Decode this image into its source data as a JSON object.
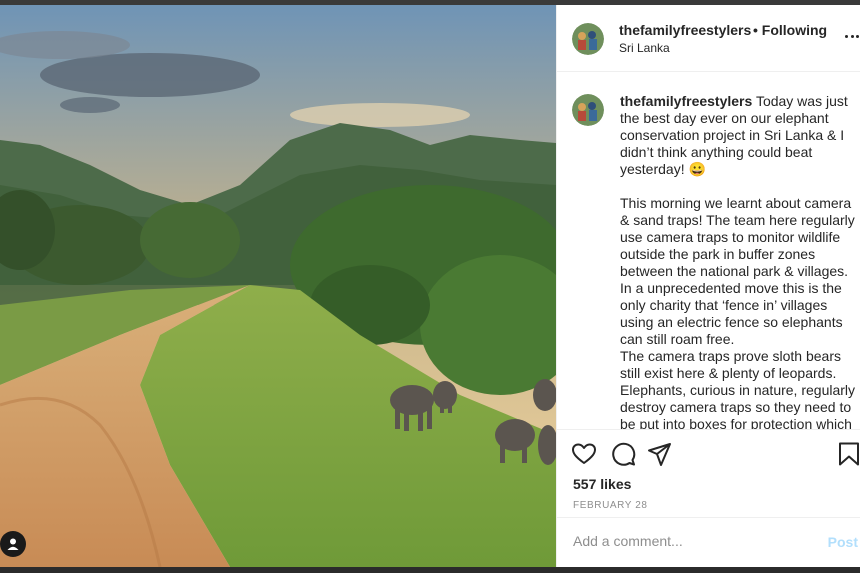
{
  "post": {
    "username": "thefamilyfreestylers",
    "follow_status": "• Following",
    "location": "Sri Lanka",
    "more_icon": "more-options-icon",
    "caption": {
      "username": "thefamilyfreestylers",
      "paragraph1": "Today was just the best day ever on our elephant conservation project in Sri Lanka & I didn’t think anything could beat yesterday! 😀",
      "paragraph2": "This morning we learnt about camera & sand traps! The team here regularly use camera traps to monitor wildlife outside the park in buffer zones between the national park & villages. In a unprecedented move this is the only charity that ‘fence in’ villages using an electric fence so elephants can still roam free.",
      "paragraph3": "The camera traps prove sloth bears still exist here & plenty of leopards. Elephants, curious in nature, regularly destroy camera traps so they need to be put into boxes for protection which is"
    },
    "actions": {
      "like_icon": "heart-icon",
      "comment_icon": "comment-icon",
      "share_icon": "paper-plane-icon",
      "save_icon": "bookmark-icon"
    },
    "likes": "557 likes",
    "date": "FEBRUARY 28",
    "comment_placeholder": "Add a comment...",
    "post_button": "Post"
  },
  "colors": {
    "text": "#262626",
    "muted": "#8e8e8e",
    "post_button_disabled": "#b2dffc",
    "border": "#efefef"
  }
}
